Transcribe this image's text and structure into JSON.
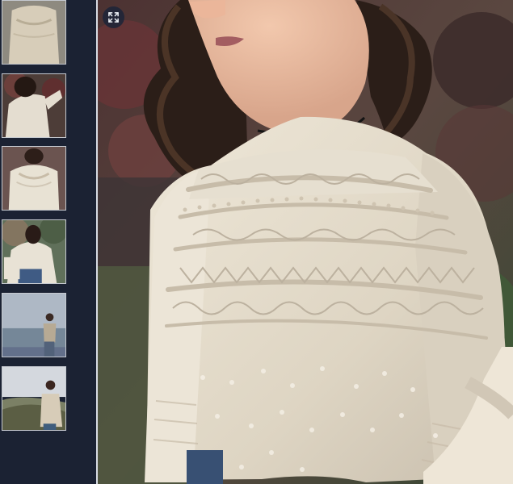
{
  "gallery": {
    "thumbnails": [
      {
        "icon": "sweater-front-thumbnail",
        "selected": false
      },
      {
        "icon": "sweater-back-thumbnail",
        "selected": false
      },
      {
        "icon": "sweater-seated-thumbnail",
        "selected": false
      },
      {
        "icon": "sweater-outdoor-thumbnail",
        "selected": false
      },
      {
        "icon": "coastal-lookout-thumbnail",
        "selected": false
      },
      {
        "icon": "hillside-portrait-thumbnail",
        "selected": false
      }
    ],
    "main_image": {
      "icon": "cream-yoke-sweater-photo"
    },
    "expand_icon": "expand-icon"
  },
  "colors": {
    "rail_background": "#1b2233",
    "rail_border": "#d7dbe3",
    "sweater_cream": "#e6dfcf",
    "hair_dark": "#2b1e18"
  }
}
